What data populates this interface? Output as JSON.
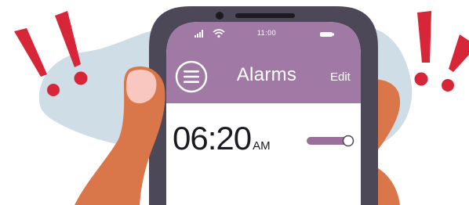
{
  "status_bar": {
    "time": "11:00",
    "signal_icon": "cellular-signal-icon",
    "wifi_icon": "wifi-icon",
    "battery_icon": "battery-icon"
  },
  "header": {
    "menu_icon": "hamburger-menu-icon",
    "title": "Alarms",
    "edit_label": "Edit"
  },
  "alarm": {
    "time": "06:20",
    "period": "AM",
    "toggle_on": true
  },
  "colors": {
    "header_purple": "#a07aa4",
    "phone_frame": "#4d4858",
    "exclamation_red": "#d72638",
    "skin": "#d9774a",
    "backdrop_blue": "#cfdde7"
  }
}
